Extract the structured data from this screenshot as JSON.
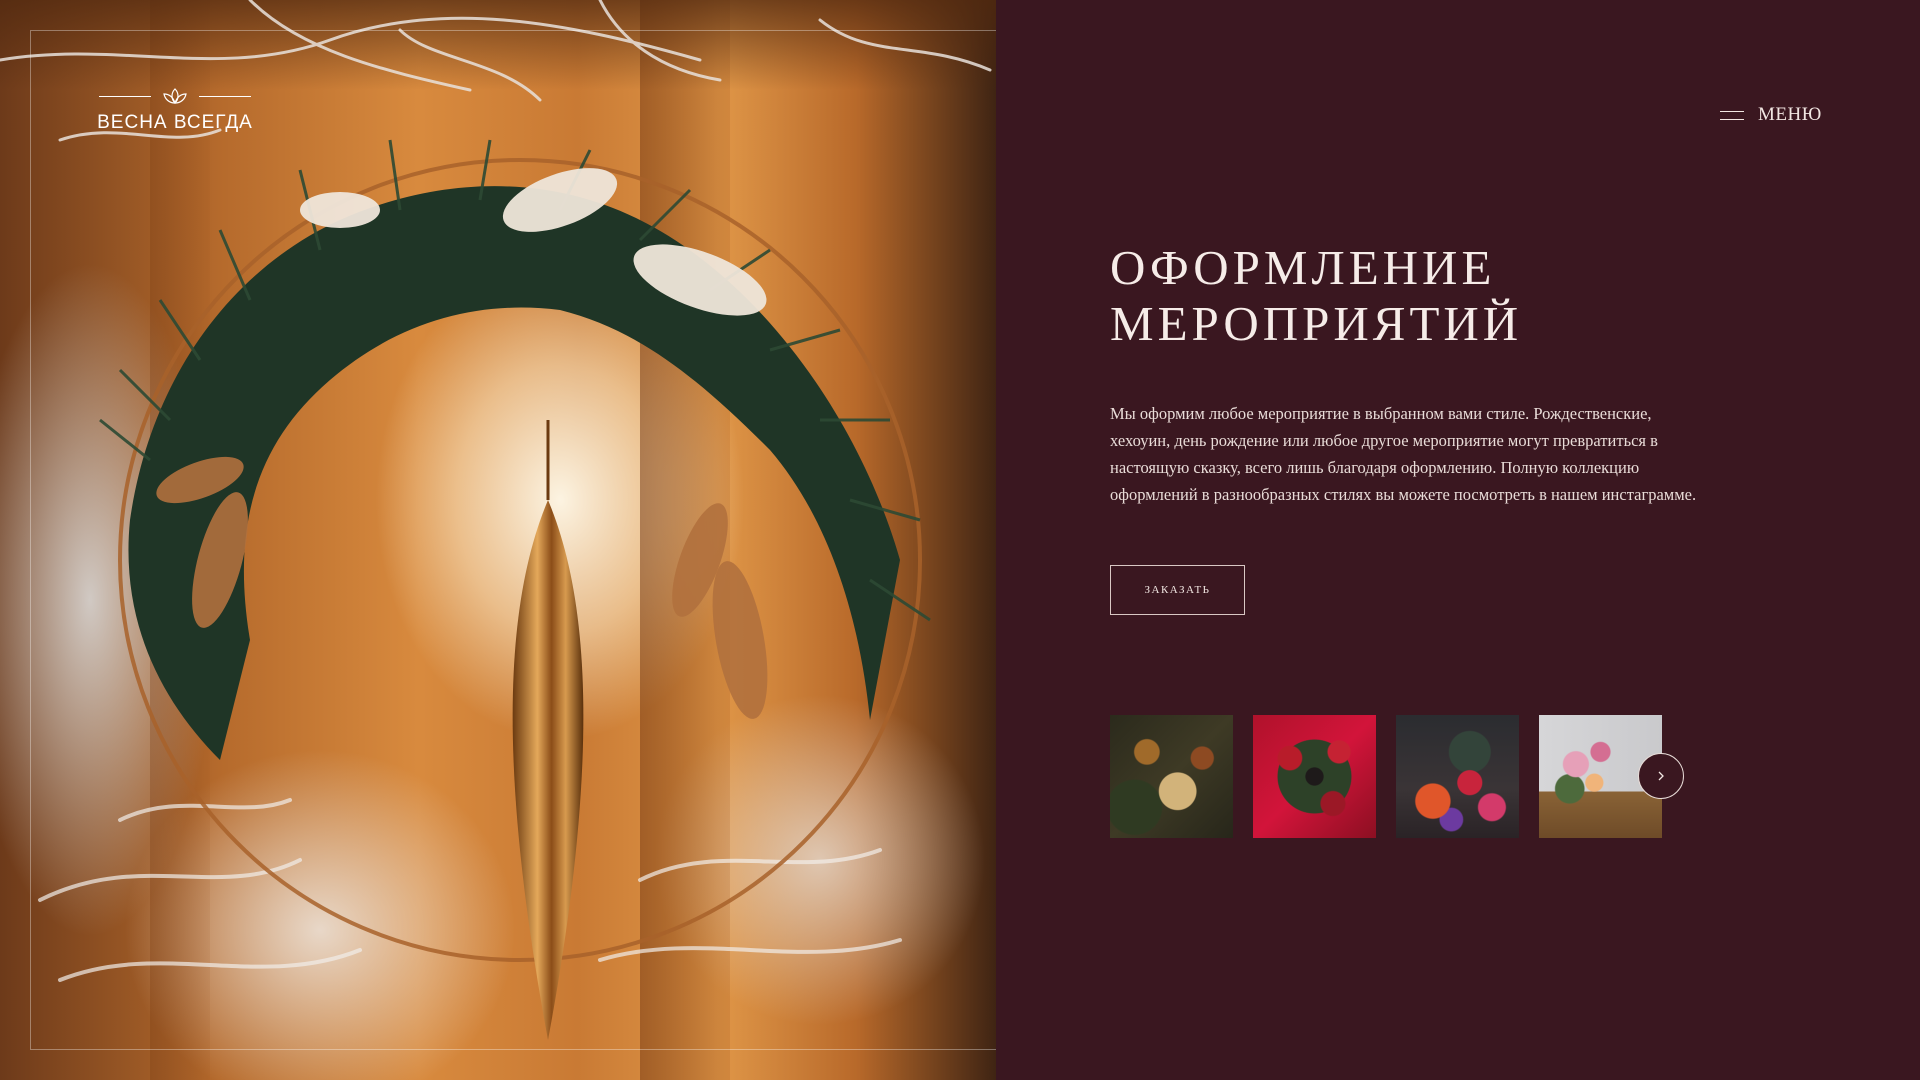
{
  "brand": {
    "name": "ВЕСНА ВСЕГДА",
    "logo_icon": "lotus-icon"
  },
  "menu": {
    "label": "МЕНЮ",
    "icon": "hamburger-icon"
  },
  "hero": {
    "title_line1": "ОФОРМЛЕНИЕ",
    "title_line2": "МЕРОПРИЯТИЙ",
    "description": "Мы оформим любое мероприятие в выбранном вами стиле. Рождественские, хехоуин, день рождение или любое другое мероприятие могут превратиться в настоящую сказку, всего лишь благодаря оформлению. Полную коллекцию оформлений в разнообразных стилях вы можете посмотреть в нашем инстаграмме.",
    "order_button": "ЗАКАЗАТЬ"
  },
  "gallery": {
    "items": [
      "wreath-gold-thumbnail",
      "wreath-red-thumbnail",
      "bouquet-dark-thumbnail",
      "bouquet-basket-thumbnail"
    ],
    "next_icon": "chevron-right-icon"
  },
  "colors": {
    "background": "#3a1720",
    "text": "#f1e6e2"
  }
}
